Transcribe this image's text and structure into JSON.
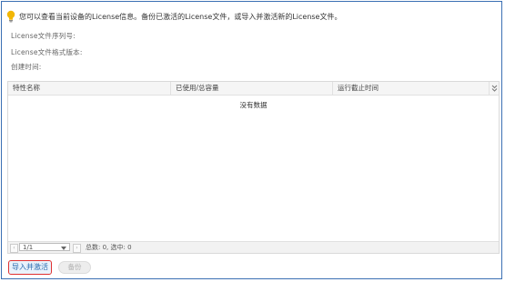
{
  "tip": {
    "icon": "lightbulb-icon",
    "text": "您可以查看当前设备的License信息。备份已激活的License文件，或导入并激活新的License文件。"
  },
  "info": {
    "serial_label": "License文件序列号:",
    "format_version_label": "License文件格式版本:",
    "created_label": "创建时间:"
  },
  "table": {
    "columns": [
      "特性名称",
      "已使用/总容量",
      "运行截止时间"
    ],
    "column_menu_icon": "double-chevron-down-icon",
    "empty_text": "没有数据",
    "rows": []
  },
  "pager": {
    "page_value": "1/1",
    "summary": "总数: 0, 选中: 0"
  },
  "buttons": {
    "import_activate": "导入并激活",
    "backup": "备份"
  },
  "colors": {
    "frame_border": "#3b6fb3",
    "highlight_border": "#e03131",
    "bulb": "#f2b705"
  }
}
